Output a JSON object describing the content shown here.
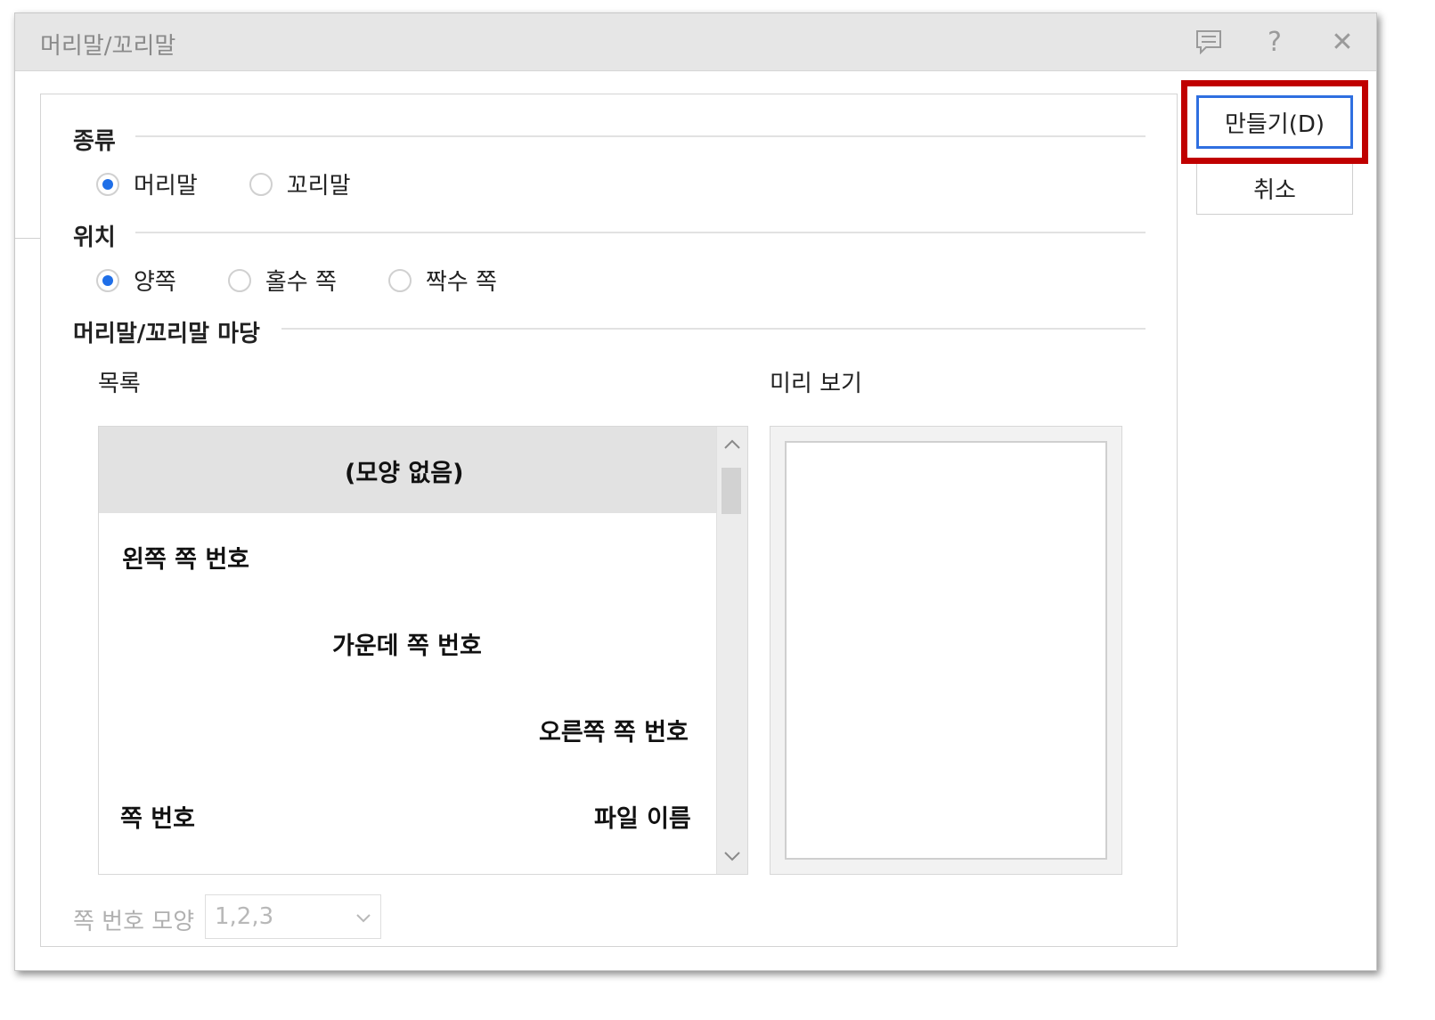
{
  "dialog": {
    "title": "머리말/꼬리말",
    "icons": [
      "comment-icon",
      "help-icon",
      "close-icon"
    ],
    "icon_glyphs": {
      "help": "?",
      "close": "✕"
    }
  },
  "kind": {
    "label": "종류",
    "options": [
      {
        "label": "머리말",
        "selected": true
      },
      {
        "label": "꼬리말",
        "selected": false
      }
    ]
  },
  "position": {
    "label": "위치",
    "options": [
      {
        "label": "양쪽",
        "selected": true
      },
      {
        "label": "홀수 쪽",
        "selected": false
      },
      {
        "label": "짝수 쪽",
        "selected": false
      }
    ]
  },
  "area": {
    "label": "머리말/꼬리말 마당",
    "list_label": "목록",
    "preview_label": "미리 보기",
    "list_items": [
      {
        "left": "",
        "center": "(모양 없음)",
        "right": "",
        "selected": true
      },
      {
        "left": "왼쪽 쪽 번호",
        "center": "",
        "right": ""
      },
      {
        "left": "",
        "center": "가운데 쪽 번호",
        "right": ""
      },
      {
        "left": "",
        "center": "",
        "right": "오른쪽 쪽 번호"
      },
      {
        "left": "쪽 번호",
        "center": "",
        "right": "파일 이름"
      }
    ]
  },
  "page_number_format": {
    "label": "쪽 번호 모양",
    "value": "1,2,3"
  },
  "buttons": {
    "create": "만들기(D)",
    "cancel": "취소"
  },
  "colors": {
    "accent": "#1f6fe8",
    "highlight": "#c00000",
    "primary_border": "#2f6fe0"
  }
}
